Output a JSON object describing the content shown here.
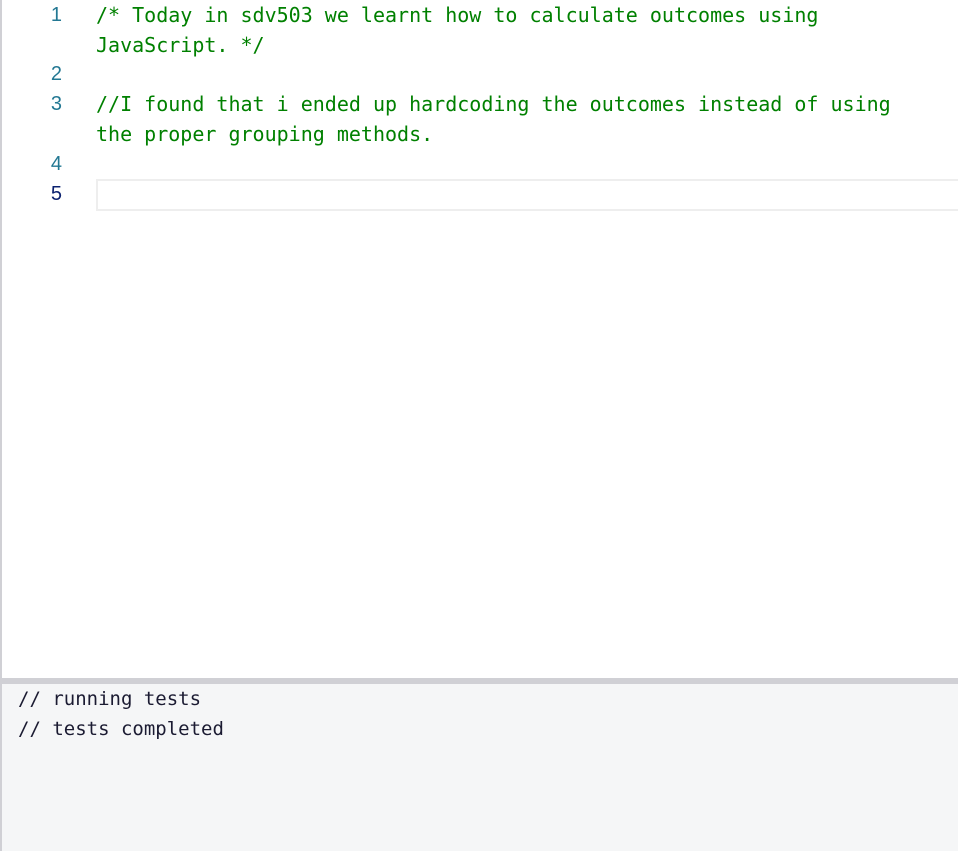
{
  "editor": {
    "lines": [
      {
        "number": "1",
        "text": "/* Today in sdv503 we learnt how to calculate outcomes using\nJavaScript. */"
      },
      {
        "number": "2",
        "text": ""
      },
      {
        "number": "3",
        "text": "//I found that i ended up hardcoding the outcomes instead of using\nthe proper grouping methods."
      },
      {
        "number": "4",
        "text": ""
      },
      {
        "number": "5",
        "text": ""
      }
    ],
    "active_line": "5",
    "comment_color": "#008000",
    "line_number_color": "#237893"
  },
  "console": {
    "lines": [
      "// running tests",
      "// tests completed"
    ],
    "background": "#f5f6f7"
  }
}
